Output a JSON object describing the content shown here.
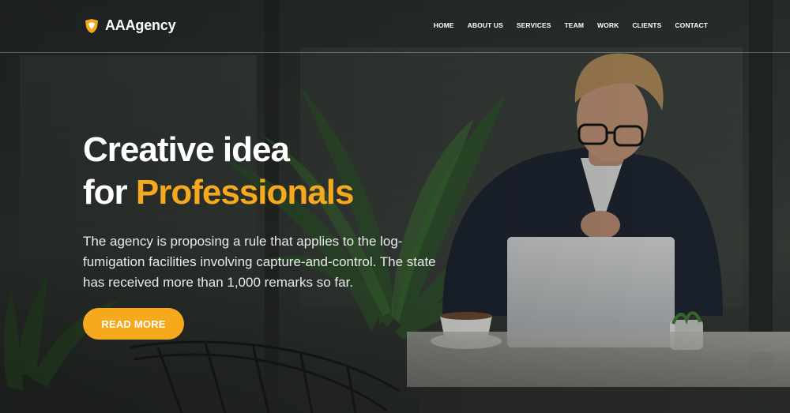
{
  "brand": {
    "name": "AAAgency",
    "accent_color": "#f7a91e",
    "logo_icon": "shield-logo-icon"
  },
  "nav": {
    "items": [
      {
        "label": "HOME"
      },
      {
        "label": "ABOUT US"
      },
      {
        "label": "SERVICES"
      },
      {
        "label": "TEAM"
      },
      {
        "label": "WORK"
      },
      {
        "label": "CLIENTS"
      },
      {
        "label": "CONTACT"
      }
    ]
  },
  "hero": {
    "title_line1": "Creative idea",
    "title_line2_prefix": "for",
    "title_line2_accent": "Professionals",
    "description": "The agency is proposing a rule that applies to the log-fumigation facilities involving capture-and-control. The state has received more than 1,000 remarks so far.",
    "cta_label": "READ MORE"
  }
}
